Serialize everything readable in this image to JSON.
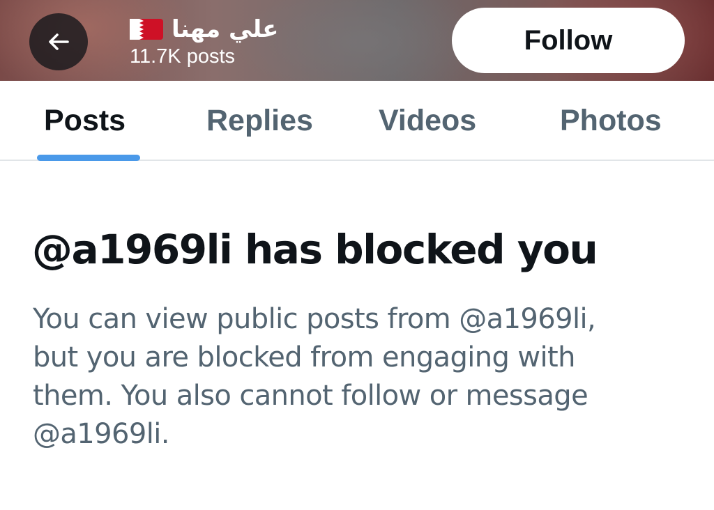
{
  "header": {
    "back_icon": "arrow-left-icon",
    "name": "علي مهنا",
    "flag_icon": "bahrain-flag-icon",
    "post_count": "11.7K posts",
    "follow_label": "Follow"
  },
  "tabs": [
    {
      "label": "Posts",
      "active": true
    },
    {
      "label": "Replies",
      "active": false
    },
    {
      "label": "Videos",
      "active": false
    },
    {
      "label": "Photos",
      "active": false
    }
  ],
  "blocked": {
    "title": "@a1969li has blocked you",
    "body_lines": [
      "You can view public posts from @a1969li,",
      "but you are blocked from engaging with",
      "them. You also cannot follow or message",
      "@a1969li."
    ]
  },
  "colors": {
    "accent": "#4a99e9",
    "text_primary": "#0f1419",
    "text_secondary": "#536471",
    "flag_red": "#ce1126"
  }
}
